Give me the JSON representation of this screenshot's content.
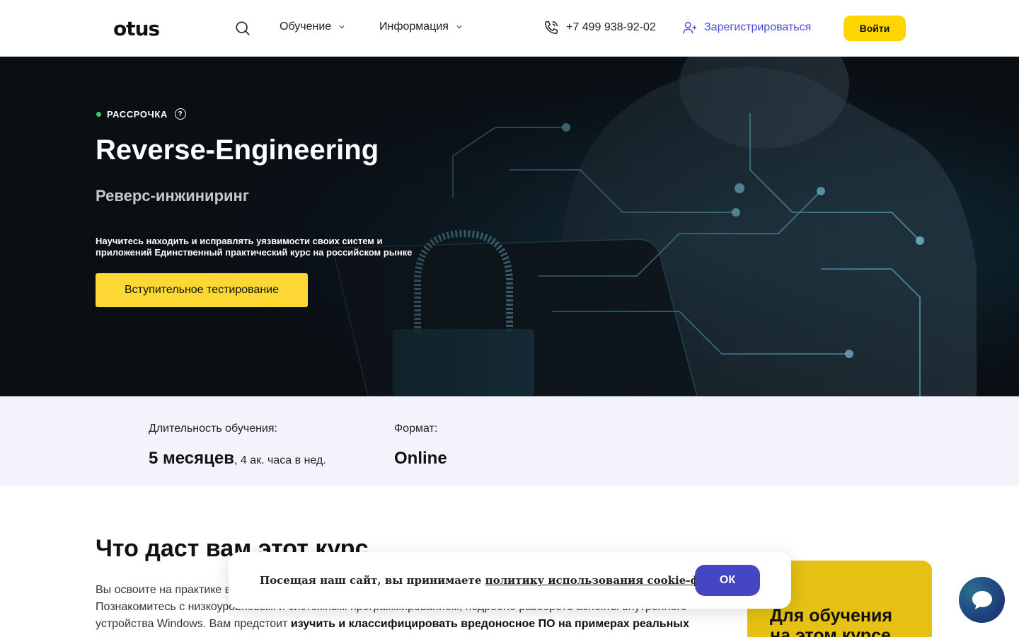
{
  "header": {
    "logo": "otus",
    "nav": [
      {
        "label": "Обучение"
      },
      {
        "label": "Информация"
      }
    ],
    "phone": "+7 499 938-92-02",
    "register_label": "Зарегистрироваться",
    "login_label": "Войти"
  },
  "hero": {
    "badge": "РАССРОЧКА",
    "badge_help": "?",
    "title": "Reverse-Engineering",
    "subtitle": "Реверс-инжиниринг",
    "description": "Научитесь находить и исправлять уязвимости своих систем и приложений Единственный практический курс на российском рынке",
    "cta_label": "Вступительное тестирование"
  },
  "info": {
    "duration_label": "Длительность обучения:",
    "duration_value": "5 месяцев",
    "duration_extra": ", 4 ак. часа в нед.",
    "format_label": "Формат:",
    "format_value": "Online"
  },
  "section": {
    "title": "Что даст вам этот курс",
    "text_1": "Вы освоите на практике в",
    "text_2": "Познакомитесь с низкоуровневым и системным программированием, подробно разберёте аспекты внутреннего",
    "text_3": "устройства Windows. Вам предстоит ",
    "text_3_bold": "изучить и классифицировать вредоносное ПО на примерах реальных"
  },
  "side_card": {
    "title": "Для обучения на этом курсе"
  },
  "cookie": {
    "text": "Посещая наш сайт, вы принимаете ",
    "link": "политику использования cookie-файлов",
    "ok_label": "ОК"
  },
  "colors": {
    "accent_yellow": "#ffd500",
    "brand_blue": "#4646c4",
    "link_blue": "#4b4bd8"
  }
}
